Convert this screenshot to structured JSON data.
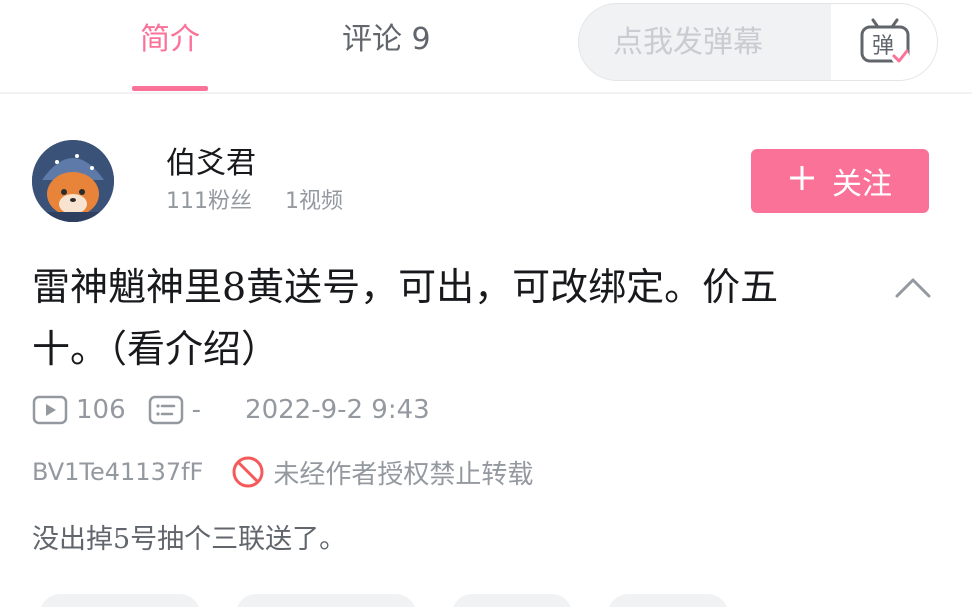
{
  "tabs": {
    "intro_label": "简介",
    "comments_label": "评论 9"
  },
  "danmaku": {
    "placeholder": "点我发弹幕",
    "button_glyph": "弹"
  },
  "author": {
    "name": "伯爻君",
    "fans": "111粉丝",
    "videos": "1视频",
    "follow_label": "关注"
  },
  "video": {
    "title": "雷神魈神里8黄送号，可出，可改绑定。价五十。（看介绍）",
    "play_count": "106",
    "danmaku_count": "-",
    "date": "2022-9-2 9:43",
    "bvid": "BV1Te41137fF",
    "copyright_notice": "未经作者授权禁止转载",
    "description": "没出掉5号抽个三联送了。"
  },
  "colors": {
    "accent": "#fb7299",
    "muted_text": "#9499a0",
    "warning_red": "#f45a5a"
  },
  "icons": [
    "play-count-icon",
    "danmaku-count-icon",
    "no-repost-icon",
    "collapse-chevron-icon",
    "danmaku-tv-icon"
  ]
}
